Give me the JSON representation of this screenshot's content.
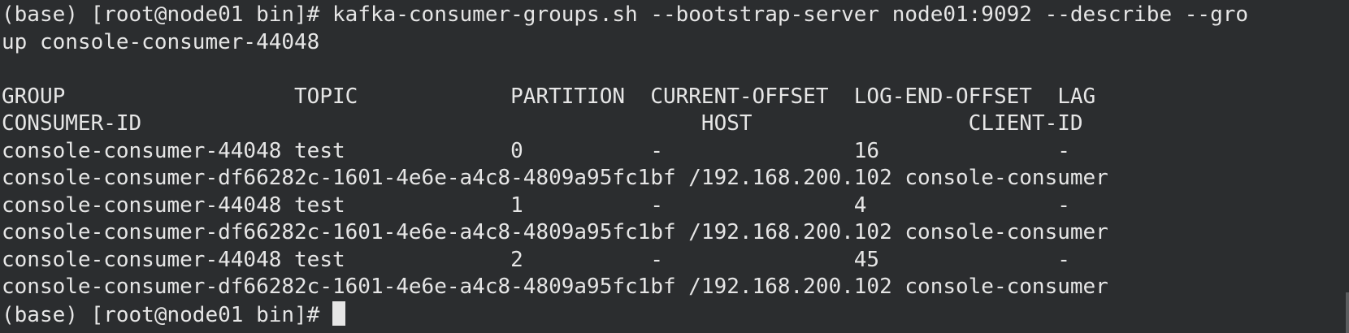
{
  "terminal": {
    "command_line_1": "(base) [root@node01 bin]# kafka-consumer-groups.sh --bootstrap-server node01:9092 --describe --gro",
    "command_line_2": "up console-consumer-44048",
    "header_line_1": "GROUP                  TOPIC            PARTITION  CURRENT-OFFSET  LOG-END-OFFSET  LAG",
    "header_line_2": "CONSUMER-ID                                            HOST                 CLIENT-ID",
    "rows": [
      {
        "line_1": "console-consumer-44048 test             0          -               16              -",
        "line_2": "console-consumer-df66282c-1601-4e6e-a4c8-4809a95fc1bf /192.168.200.102 console-consumer"
      },
      {
        "line_1": "console-consumer-44048 test             1          -               4               -",
        "line_2": "console-consumer-df66282c-1601-4e6e-a4c8-4809a95fc1bf /192.168.200.102 console-consumer"
      },
      {
        "line_1": "console-consumer-44048 test             2          -               45              -",
        "line_2": "console-consumer-df66282c-1601-4e6e-a4c8-4809a95fc1bf /192.168.200.102 console-consumer"
      }
    ],
    "prompt": "(base) [root@node01 bin]# "
  },
  "colors": {
    "background": "#2b2d2f",
    "foreground": "#e6e6e6"
  }
}
